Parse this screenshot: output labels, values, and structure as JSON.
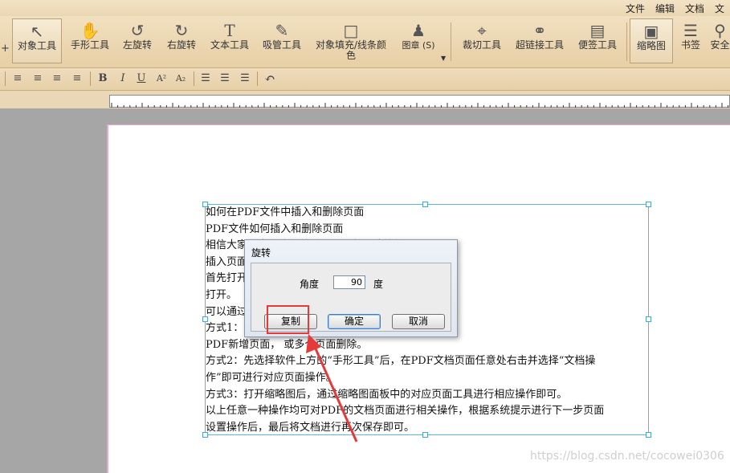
{
  "menu": {
    "items": [
      "文件",
      "编辑",
      "文档",
      "文"
    ]
  },
  "toolbar": {
    "left_marker": "+",
    "tools": [
      {
        "label": "对象工具",
        "icon": "cursor-icon"
      },
      {
        "label": "手形工具",
        "icon": "hand-icon"
      },
      {
        "label": "左旋转",
        "icon": "rotate-left-icon"
      },
      {
        "label": "右旋转",
        "icon": "rotate-right-icon"
      },
      {
        "label": "文本工具",
        "icon": "text-icon"
      },
      {
        "label": "吸管工具",
        "icon": "eyedropper-icon"
      },
      {
        "label": "对象填充/线条颜色",
        "icon": "fill-color-icon"
      },
      {
        "label": "图章 (S)",
        "icon": "stamp-icon"
      },
      {
        "label": "裁切工具",
        "icon": "crop-icon"
      },
      {
        "label": "超链接工具",
        "icon": "link-icon"
      },
      {
        "label": "便签工具",
        "icon": "note-icon"
      },
      {
        "label": "缩略图",
        "icon": "thumbnail-icon"
      },
      {
        "label": "书签",
        "icon": "bookmark-icon"
      },
      {
        "label": "安全",
        "icon": "lock-icon"
      }
    ]
  },
  "format_bar": {
    "buttons": [
      "align-left-icon",
      "align-center-icon",
      "align-right-icon",
      "justify-icon",
      "bold-icon",
      "italic-icon",
      "underline-icon",
      "superscript-icon",
      "subscript-icon",
      "list-icon",
      "list-alt-icon",
      "indent-icon",
      "undo-icon"
    ],
    "glyphs": {
      "bold": "B",
      "italic": "I",
      "underline": "U",
      "superscript": "A²",
      "subscript": "A₂"
    }
  },
  "document": {
    "lines": [
      "如何在PDF文件中插入和删除页面",
      "PDF文件如何插入和删除页面",
      "相信大家                                                  F文件也很熟悉，那么怎么才能给PDF",
      "插入页面",
      "首先打开                                       的“打开”并选择需要操作的PDF文档",
      "打开。",
      "可以通过                                          面删除。",
      "方式1：                                           可以选择插入新页面和从文件插入给",
      "PDF新增页面，                                    或多个页面删除。",
      "方式2：先选择软件上方的“手形工具”后，在PDF文档页面任意处右击并选择“文档操",
      "作”即可进行对应页面操作。",
      "方式3：打开缩略图后，通过缩略图面板中的对应页面工具进行相应操作即可。",
      "以上任意一种操作均可对PDF的文档页面进行相关操作，根据系统提示进行下一步页面",
      "设置操作后，最后将文档进行再次保存即可。"
    ]
  },
  "dialog": {
    "title": "旋转",
    "angle_label": "角度",
    "angle_value": "90",
    "degree_label": "度",
    "copy_button": "复制",
    "ok_button": "确定",
    "cancel_button": "取消"
  },
  "watermark": "https://blog.csdn.net/cocowei0306",
  "colors": {
    "highlight": "#e63a3a",
    "selection": "#5fb6d6",
    "toolbar": "#ead6b2"
  }
}
